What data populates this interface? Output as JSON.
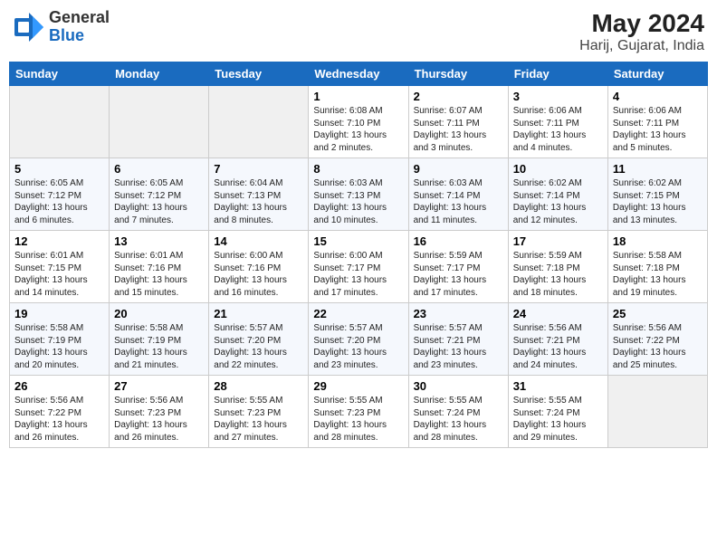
{
  "header": {
    "logo_general": "General",
    "logo_blue": "Blue",
    "month_year": "May 2024",
    "location": "Harij, Gujarat, India"
  },
  "days_of_week": [
    "Sunday",
    "Monday",
    "Tuesday",
    "Wednesday",
    "Thursday",
    "Friday",
    "Saturday"
  ],
  "weeks": [
    [
      {
        "day": "",
        "info": ""
      },
      {
        "day": "",
        "info": ""
      },
      {
        "day": "",
        "info": ""
      },
      {
        "day": "1",
        "info": "Sunrise: 6:08 AM\nSunset: 7:10 PM\nDaylight: 13 hours\nand 2 minutes."
      },
      {
        "day": "2",
        "info": "Sunrise: 6:07 AM\nSunset: 7:11 PM\nDaylight: 13 hours\nand 3 minutes."
      },
      {
        "day": "3",
        "info": "Sunrise: 6:06 AM\nSunset: 7:11 PM\nDaylight: 13 hours\nand 4 minutes."
      },
      {
        "day": "4",
        "info": "Sunrise: 6:06 AM\nSunset: 7:11 PM\nDaylight: 13 hours\nand 5 minutes."
      }
    ],
    [
      {
        "day": "5",
        "info": "Sunrise: 6:05 AM\nSunset: 7:12 PM\nDaylight: 13 hours\nand 6 minutes."
      },
      {
        "day": "6",
        "info": "Sunrise: 6:05 AM\nSunset: 7:12 PM\nDaylight: 13 hours\nand 7 minutes."
      },
      {
        "day": "7",
        "info": "Sunrise: 6:04 AM\nSunset: 7:13 PM\nDaylight: 13 hours\nand 8 minutes."
      },
      {
        "day": "8",
        "info": "Sunrise: 6:03 AM\nSunset: 7:13 PM\nDaylight: 13 hours\nand 10 minutes."
      },
      {
        "day": "9",
        "info": "Sunrise: 6:03 AM\nSunset: 7:14 PM\nDaylight: 13 hours\nand 11 minutes."
      },
      {
        "day": "10",
        "info": "Sunrise: 6:02 AM\nSunset: 7:14 PM\nDaylight: 13 hours\nand 12 minutes."
      },
      {
        "day": "11",
        "info": "Sunrise: 6:02 AM\nSunset: 7:15 PM\nDaylight: 13 hours\nand 13 minutes."
      }
    ],
    [
      {
        "day": "12",
        "info": "Sunrise: 6:01 AM\nSunset: 7:15 PM\nDaylight: 13 hours\nand 14 minutes."
      },
      {
        "day": "13",
        "info": "Sunrise: 6:01 AM\nSunset: 7:16 PM\nDaylight: 13 hours\nand 15 minutes."
      },
      {
        "day": "14",
        "info": "Sunrise: 6:00 AM\nSunset: 7:16 PM\nDaylight: 13 hours\nand 16 minutes."
      },
      {
        "day": "15",
        "info": "Sunrise: 6:00 AM\nSunset: 7:17 PM\nDaylight: 13 hours\nand 17 minutes."
      },
      {
        "day": "16",
        "info": "Sunrise: 5:59 AM\nSunset: 7:17 PM\nDaylight: 13 hours\nand 17 minutes."
      },
      {
        "day": "17",
        "info": "Sunrise: 5:59 AM\nSunset: 7:18 PM\nDaylight: 13 hours\nand 18 minutes."
      },
      {
        "day": "18",
        "info": "Sunrise: 5:58 AM\nSunset: 7:18 PM\nDaylight: 13 hours\nand 19 minutes."
      }
    ],
    [
      {
        "day": "19",
        "info": "Sunrise: 5:58 AM\nSunset: 7:19 PM\nDaylight: 13 hours\nand 20 minutes."
      },
      {
        "day": "20",
        "info": "Sunrise: 5:58 AM\nSunset: 7:19 PM\nDaylight: 13 hours\nand 21 minutes."
      },
      {
        "day": "21",
        "info": "Sunrise: 5:57 AM\nSunset: 7:20 PM\nDaylight: 13 hours\nand 22 minutes."
      },
      {
        "day": "22",
        "info": "Sunrise: 5:57 AM\nSunset: 7:20 PM\nDaylight: 13 hours\nand 23 minutes."
      },
      {
        "day": "23",
        "info": "Sunrise: 5:57 AM\nSunset: 7:21 PM\nDaylight: 13 hours\nand 23 minutes."
      },
      {
        "day": "24",
        "info": "Sunrise: 5:56 AM\nSunset: 7:21 PM\nDaylight: 13 hours\nand 24 minutes."
      },
      {
        "day": "25",
        "info": "Sunrise: 5:56 AM\nSunset: 7:22 PM\nDaylight: 13 hours\nand 25 minutes."
      }
    ],
    [
      {
        "day": "26",
        "info": "Sunrise: 5:56 AM\nSunset: 7:22 PM\nDaylight: 13 hours\nand 26 minutes."
      },
      {
        "day": "27",
        "info": "Sunrise: 5:56 AM\nSunset: 7:23 PM\nDaylight: 13 hours\nand 26 minutes."
      },
      {
        "day": "28",
        "info": "Sunrise: 5:55 AM\nSunset: 7:23 PM\nDaylight: 13 hours\nand 27 minutes."
      },
      {
        "day": "29",
        "info": "Sunrise: 5:55 AM\nSunset: 7:23 PM\nDaylight: 13 hours\nand 28 minutes."
      },
      {
        "day": "30",
        "info": "Sunrise: 5:55 AM\nSunset: 7:24 PM\nDaylight: 13 hours\nand 28 minutes."
      },
      {
        "day": "31",
        "info": "Sunrise: 5:55 AM\nSunset: 7:24 PM\nDaylight: 13 hours\nand 29 minutes."
      },
      {
        "day": "",
        "info": ""
      }
    ]
  ]
}
